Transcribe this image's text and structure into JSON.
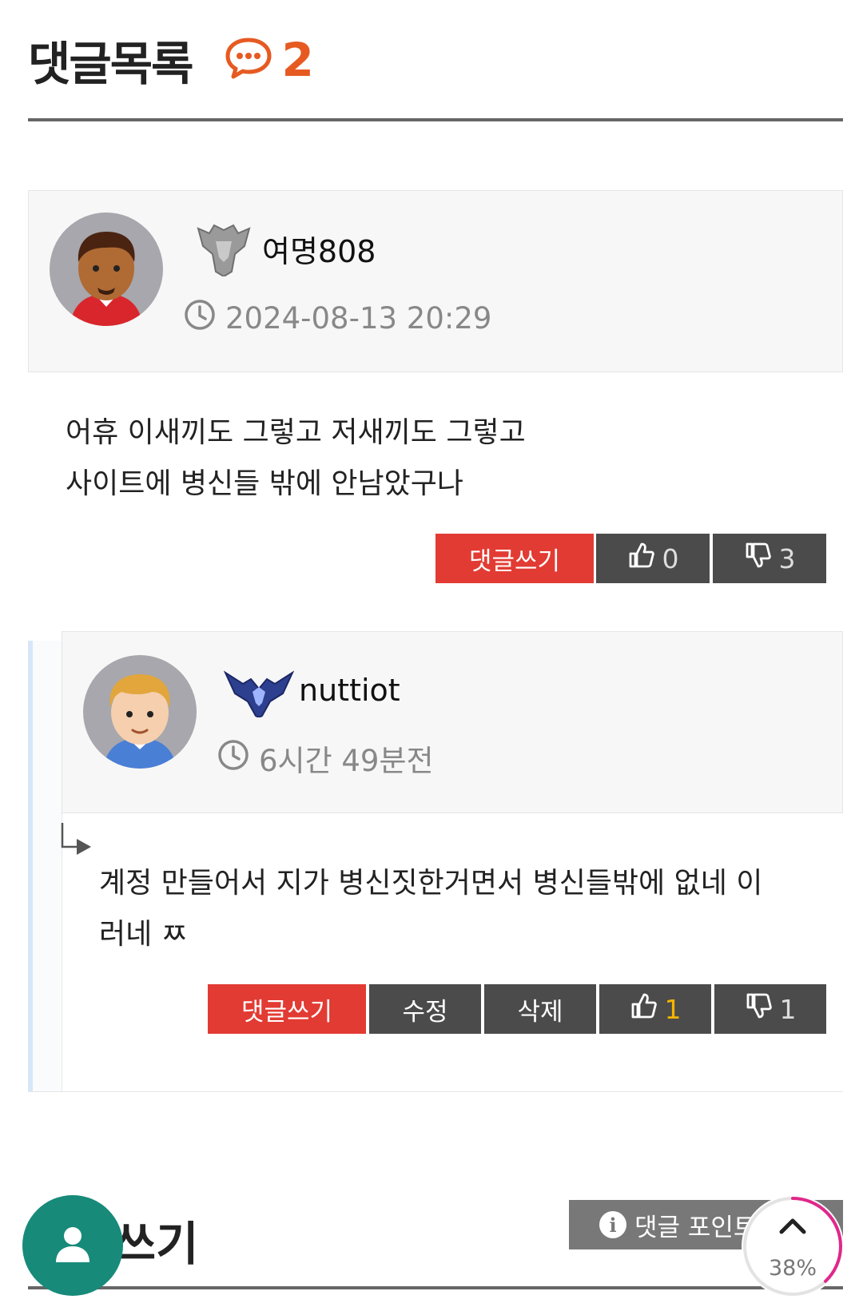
{
  "header": {
    "title": "댓글목록",
    "comment_count": "2"
  },
  "comments": [
    {
      "nickname": "여명808",
      "time": "2024-08-13 20:29",
      "text_lines": [
        "어휴 이새끼도 그렇고 저새끼도 그렇고",
        "사이트에 병신들 밖에 안남았구나"
      ],
      "reply_label": "댓글쓰기",
      "likes": "0",
      "dislikes": "3"
    },
    {
      "nickname": "nuttiot",
      "time": "6시간 49분전",
      "text_lines": [
        "계정 만들어서 지가 병신짓한거면서 병신들밖에 없네 이",
        "러네 ㅉ"
      ],
      "reply_label": "댓글쓰기",
      "edit_label": "수정",
      "delete_label": "삭제",
      "likes": "1",
      "dislikes": "1"
    }
  ],
  "write": {
    "title": "댓글쓰기",
    "point_label": "댓글 포인트"
  },
  "scroll": {
    "percent": "38%",
    "progress": 0.38
  },
  "colors": {
    "accent_orange": "#e65a22",
    "reply_red": "#e23b33",
    "dark_button": "#4b4b4b",
    "fab_teal": "#178a7a",
    "progress_pink": "#e0288a"
  }
}
